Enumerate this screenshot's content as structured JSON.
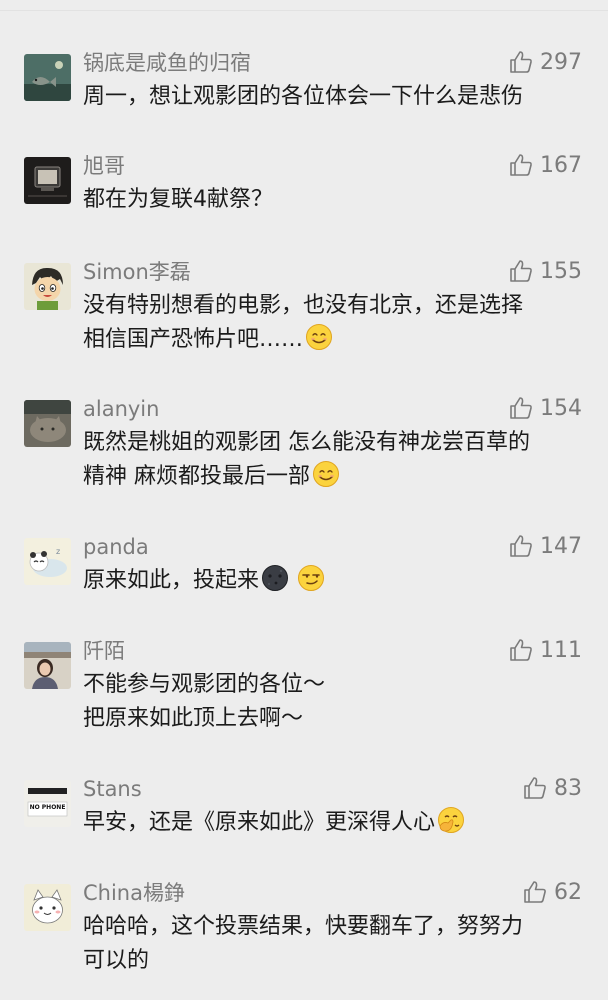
{
  "comments": [
    {
      "username": "锅底是咸鱼的归宿",
      "likes": "297",
      "avatar": "fish-night-avatar-icon",
      "lines": [
        "周一，想让观影团的各位体会一下什么是悲伤"
      ]
    },
    {
      "username": "旭哥",
      "likes": "167",
      "avatar": "dark-tv-avatar-icon",
      "lines": [
        "都在为复联4献祭？"
      ]
    },
    {
      "username": "Simon李磊",
      "likes": "155",
      "avatar": "cartoon-boy-avatar-icon",
      "lines": [
        "没有特别想看的电影，也没有北京，还是选择",
        "相信国产恐怖片吧……"
      ],
      "emoji": "smile-emoji-icon"
    },
    {
      "username": "alanyin",
      "likes": "154",
      "avatar": "cat-avatar-icon",
      "lines": [
        "既然是桃姐的观影团 怎么能没有神龙尝百草的",
        "精神 麻烦都投最后一部"
      ],
      "emoji": "smile-emoji-icon"
    },
    {
      "username": "panda",
      "likes": "147",
      "avatar": "sleeping-panda-avatar-icon",
      "lines": [
        "原来如此，投起来"
      ],
      "emoji": "dark-moon-emoji-icon",
      "emoji2": "smirk-emoji-icon"
    },
    {
      "username": "阡陌",
      "likes": "111",
      "avatar": "girl-photo-avatar-icon",
      "lines": [
        "不能参与观影团的各位～",
        "把原来如此顶上去啊～"
      ]
    },
    {
      "username": "Stans",
      "likes": "83",
      "avatar": "no-phone-sign-avatar-icon",
      "avatar_text": "NO PHONE",
      "lines": [
        "早安，还是《原来如此》更深得人心"
      ],
      "emoji": "facepalm-emoji-icon"
    },
    {
      "username": "China楊錚",
      "likes": "62",
      "avatar": "white-cat-avatar-icon",
      "lines": [
        "哈哈哈，这个投票结果，快要翻车了，努努力",
        "可以的"
      ]
    }
  ],
  "colors": {
    "background": "#ededed",
    "meta_text": "#7b7b7b",
    "body_text": "#1b1b1b"
  }
}
